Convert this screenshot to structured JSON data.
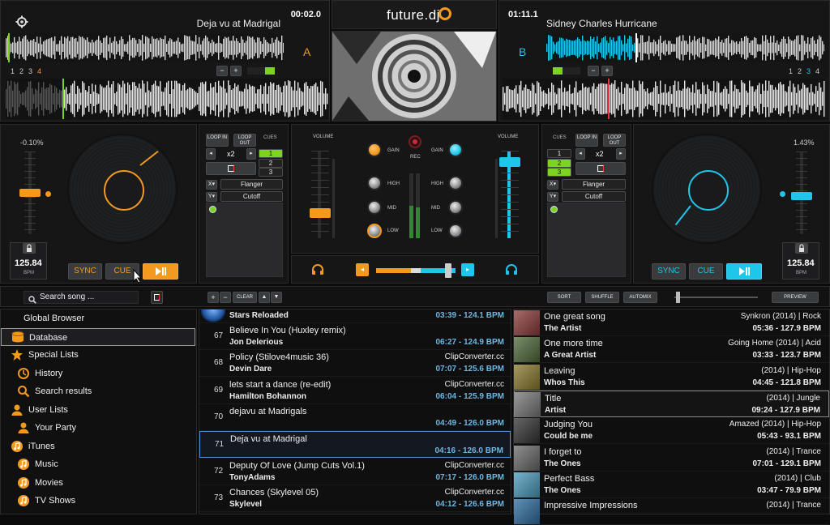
{
  "brand": {
    "name": "future.dj"
  },
  "deck_a": {
    "title": "Deja vu at Madrigal",
    "time": "00:02.0",
    "letter": "A",
    "pitch": "-0.10%",
    "bpm": "125.84",
    "bpm_label": "BPM",
    "sync": "SYNC",
    "cue": "CUE",
    "loop_in": "LOOP IN",
    "loop_out": "LOOP OUT",
    "cues": "CUES",
    "loop_size": "x2",
    "cue_numbers": [
      "1",
      "2",
      "3"
    ],
    "fx1": "Flanger",
    "fx2": "Cutoff",
    "x": "X",
    "y": "Y",
    "beat_marks": [
      "1",
      "2",
      "3",
      "4"
    ]
  },
  "deck_b": {
    "title": "Sidney Charles Hurricane",
    "time": "01:11.1",
    "letter": "B",
    "pitch": "1.43%",
    "bpm": "125.84",
    "bpm_label": "BPM",
    "sync": "SYNC",
    "cue": "CUE",
    "loop_in": "LOOP IN",
    "loop_out": "LOOP OUT",
    "cues": "CUES",
    "loop_size": "x2",
    "cue_numbers": [
      "1",
      "2",
      "3"
    ],
    "fx1": "Flanger",
    "fx2": "Cutoff",
    "x": "X",
    "y": "Y",
    "beat_marks": [
      "1",
      "2",
      "3",
      "4"
    ]
  },
  "mixer": {
    "volume": "VOLUME",
    "gain": "GAIN",
    "rec": "REC",
    "high": "HIGH",
    "mid": "MID",
    "low": "LOW"
  },
  "browser_bar": {
    "search_placeholder": "Search song ...",
    "clear": "CLEAR",
    "sort": "SORT",
    "shuffle": "SHUFFLE",
    "automix": "AUTOMIX",
    "preview": "PREVIEW"
  },
  "tree": [
    {
      "label": "Global Browser",
      "icon": "none",
      "indent": 0
    },
    {
      "label": "Database",
      "icon": "database-icon",
      "indent": 0,
      "selected": true
    },
    {
      "label": "Special Lists",
      "icon": "star-icon",
      "indent": 0
    },
    {
      "label": "History",
      "icon": "history-icon",
      "indent": 1
    },
    {
      "label": "Search results",
      "icon": "search-icon",
      "indent": 1
    },
    {
      "label": "User Lists",
      "icon": "user-icon",
      "indent": 0
    },
    {
      "label": "Your Party",
      "icon": "user-icon",
      "indent": 1
    },
    {
      "label": "iTunes",
      "icon": "music-icon",
      "indent": 0
    },
    {
      "label": "Music",
      "icon": "music-icon",
      "indent": 1
    },
    {
      "label": "Movies",
      "icon": "music-icon",
      "indent": 1
    },
    {
      "label": "TV Shows",
      "icon": "music-icon",
      "indent": 1
    }
  ],
  "tracks": [
    {
      "num": "",
      "title": "Stars Reloaded",
      "artist": "",
      "source": "",
      "meta": "03:39 - 124.1 BPM"
    },
    {
      "num": "67",
      "title": "Believe In You (Huxley remix)",
      "artist": "Jon Delerious",
      "source": "",
      "meta": "06:27 - 124.9 BPM"
    },
    {
      "num": "68",
      "title": "Policy (Stilove4music 36)",
      "artist": "Devin Dare",
      "source": "ClipConverter.cc",
      "meta": "07:07 - 125.6 BPM"
    },
    {
      "num": "69",
      "title": "lets start a dance (re-edit)",
      "artist": "Hamilton Bohannon",
      "source": "ClipConverter.cc",
      "meta": "06:04 - 125.9 BPM"
    },
    {
      "num": "70",
      "title": "dejavu at Madrigals",
      "artist": "",
      "source": "",
      "meta": "04:49 - 126.0 BPM"
    },
    {
      "num": "71",
      "title": "Deja vu at Madrigal",
      "artist": "",
      "source": "",
      "meta": "04:16 - 126.0 BPM",
      "selected": true
    },
    {
      "num": "72",
      "title": "Deputy Of Love (Jump Cuts Vol.1)",
      "artist": "TonyAdams",
      "source": "ClipConverter.cc",
      "meta": "07:17 - 126.0 BPM"
    },
    {
      "num": "73",
      "title": "Chances (Skylevel 05)",
      "artist": "Skylevel",
      "source": "ClipConverter.cc",
      "meta": "04:12 - 126.6 BPM"
    }
  ],
  "suggestions": [
    {
      "title": "One great song",
      "artist": "The Artist",
      "tag": "Synkron (2014) | Rock",
      "meta": "05:36 - 127.9 BPM",
      "color": "#8b3a3a"
    },
    {
      "title": "One more time",
      "artist": "A Great Artist",
      "tag": "Going Home (2014) | Acid",
      "meta": "03:33 - 123.7 BPM",
      "color": "#4f6a3a"
    },
    {
      "title": "Leaving",
      "artist": "Whos This",
      "tag": "(2014) | Hip-Hop",
      "meta": "04:45 - 121.8 BPM",
      "color": "#8a7a2e"
    },
    {
      "title": "Title",
      "artist": "Artist",
      "tag": "(2014) | Jungle",
      "meta": "09:24 - 127.9 BPM",
      "color": "#777",
      "selected": true
    },
    {
      "title": "Judging You",
      "artist": "Could be me",
      "tag": "Amazed (2014) | Hip-Hop",
      "meta": "05:43 - 93.1 BPM",
      "color": "#333"
    },
    {
      "title": "I forget to",
      "artist": "The Ones",
      "tag": "(2014) | Trance",
      "meta": "07:01 - 129.1 BPM",
      "color": "#6a6a6a"
    },
    {
      "title": "Perfect Bass",
      "artist": "The Ones",
      "tag": "(2014) | Club",
      "meta": "03:47 - 79.9 BPM",
      "color": "#4b9bbd"
    },
    {
      "title": "Impressive Impressions",
      "artist": "",
      "tag": "(2014) | Trance",
      "meta": "",
      "color": "#2e6ca0"
    }
  ]
}
